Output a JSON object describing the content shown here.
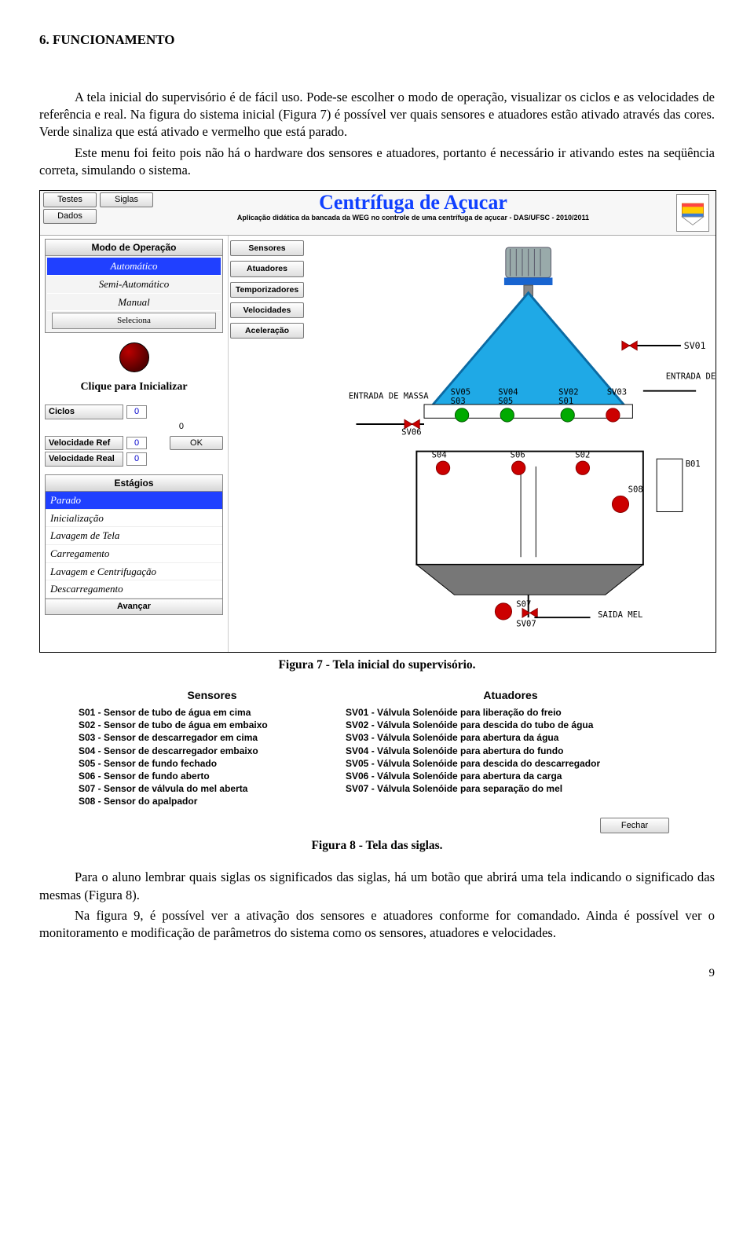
{
  "section": {
    "num_title": "6.  FUNCIONAMENTO"
  },
  "para1": "A tela inicial do supervisório é de fácil uso. Pode-se escolher o modo de operação, visualizar os ciclos e as velocidades de referência e real. Na figura do sistema inicial (Figura 7) é possível ver quais sensores e atuadores estão ativado através das cores. Verde sinaliza que está ativado e vermelho que está parado.",
  "para2": "Este menu foi feito pois não há o hardware dos sensores e atuadores, portanto é necessário ir ativando estes na seqüência correta, simulando o sistema.",
  "fig7caption": "Figura 7 - Tela inicial do supervisório.",
  "fig8caption": "Figura 8 - Tela das siglas.",
  "para3": "Para o aluno lembrar quais siglas os significados das siglas, há um botão que abrirá uma tela indicando o significado das mesmas (Figura 8).",
  "para4": "Na figura 9, é possível ver a ativação dos sensores e atuadores conforme for comandado. Ainda é possível ver o monitoramento e modificação de parâmetros do sistema como os sensores, atuadores e velocidades.",
  "pagenum": "9",
  "sup": {
    "topbtns": {
      "testes": "Testes",
      "siglas": "Siglas",
      "dados": "Dados"
    },
    "title": "Centrífuga de Açucar",
    "subtitle": "Aplicação didática da bancada da WEG no controle de uma centrífuga de açucar - DAS/UFSC - 2010/2011",
    "modo_header": "Modo de Operação",
    "modo": {
      "auto": "Automático",
      "semi": "Semi-Automático",
      "manual": "Manual",
      "sel": "Seleciona"
    },
    "init": "Clique para Inicializar",
    "ciclos_lbl": "Ciclos",
    "ciclos_val": "0",
    "free_val": "0",
    "vel_ref_lbl": "Velocidade Ref",
    "vel_ref_val": "0",
    "vel_real_lbl": "Velocidade Real",
    "vel_real_val": "0",
    "ok": "OK",
    "estagios_header": "Estágios",
    "stages": {
      "s0": "Parado",
      "s1": "Inicialização",
      "s2": "Lavagem de Tela",
      "s3": "Carregamento",
      "s4": "Lavagem e Centrifugação",
      "s5": "Descarregamento",
      "adv": "Avançar"
    },
    "menu": {
      "sensores": "Sensores",
      "atuadores": "Atuadores",
      "temps": "Temporizadores",
      "vels": "Velocidades",
      "accel": "Aceleração"
    },
    "diag": {
      "entrada_massa": "ENTRADA\nDE MASSA",
      "entrada_agua": "ENTRADA\nDE AGUA",
      "saida_mel": "SAIDA MEL",
      "sv01": "SV01",
      "sv02": "SV02",
      "sv03": "SV03",
      "sv04": "SV04",
      "sv05": "SV05",
      "sv06": "SV06",
      "sv07": "SV07",
      "s01": "S01",
      "s02": "S02",
      "s03": "S03",
      "s04": "S04",
      "s05": "S05",
      "s06": "S06",
      "s07": "S07",
      "s08": "S08",
      "b01": "B01"
    }
  },
  "siglas": {
    "h1": "Sensores",
    "h2": "Atuadores",
    "sens": {
      "s1": "S01 - Sensor de tubo de água em cima",
      "s2": "S02 - Sensor de tubo de água em embaixo",
      "s3": "S03 - Sensor de descarregador em cima",
      "s4": "S04 - Sensor de descarregador embaixo",
      "s5": "S05 - Sensor de fundo fechado",
      "s6": "S06 - Sensor de fundo aberto",
      "s7": "S07 - Sensor de válvula do mel aberta",
      "s8": "S08 - Sensor do apalpador"
    },
    "atu": {
      "a1": "SV01 - Válvula Solenóide para liberação do freio",
      "a2": "SV02 - Válvula Solenóide para descida do tubo de água",
      "a3": "SV03 - Válvula Solenóide para abertura da água",
      "a4": "SV04 - Válvula Solenóide para abertura do fundo",
      "a5": "SV05 - Válvula Solenóide para descida do descarregador",
      "a6": "SV06 - Válvula Solenóide para abertura da carga",
      "a7": "SV07 - Válvula Solenóide para separação do mel"
    },
    "fechar": "Fechar"
  }
}
